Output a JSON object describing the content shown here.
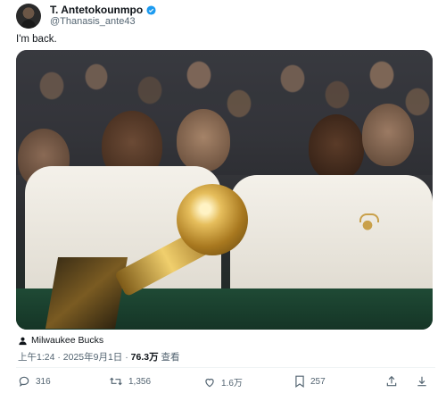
{
  "tweet": {
    "author_name": "T. Antetokounmpo",
    "handle": "@Thanasis_ante43",
    "text": "I'm back.",
    "tagged": "Milwaukee Bucks",
    "time": "上午1:24 · 2025年9月1日 · ",
    "views": "76.3万",
    "views_suffix": " 查看"
  },
  "actions": {
    "replies": "316",
    "retweets": "1,356",
    "likes": "1.6万",
    "bookmarks": "257"
  },
  "colors": {
    "verified": "#1d9bf0",
    "text_secondary": "#536471",
    "gold": "#c9a04a",
    "bucks_green": "#1f4a35"
  },
  "icons": [
    "verified-badge-icon",
    "person-tag-icon",
    "reply-icon",
    "retweet-icon",
    "like-icon",
    "bookmark-icon",
    "share-icon",
    "download-icon"
  ]
}
